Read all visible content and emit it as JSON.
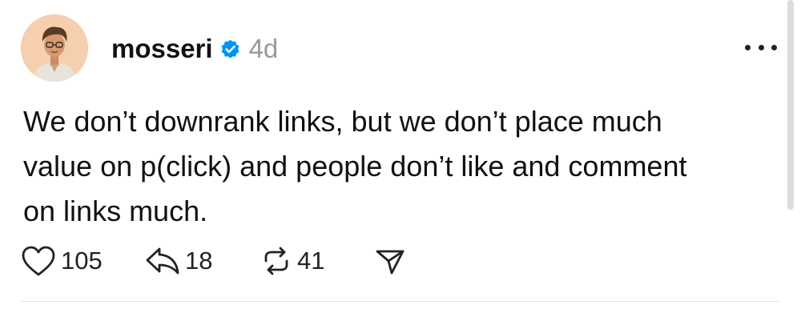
{
  "post": {
    "username": "mosseri",
    "verified": true,
    "timestamp": "4d",
    "body_lines": [
      "We don’t downrank links, but we don’t place much",
      "value on p(click) and people don’t like and comment",
      "on links much."
    ],
    "likes": "105",
    "replies": "18",
    "reposts": "41"
  },
  "icons": {
    "avatar": "user-avatar-illustration",
    "verified": "verified-badge-icon",
    "more": "more-options-icon",
    "like": "heart-icon",
    "reply": "reply-icon",
    "repost": "repost-icon",
    "share": "send-icon"
  },
  "colors": {
    "verified_badge": "#0095f6",
    "timestamp": "#9a9a9a",
    "avatar_bg": "#f3c7a3"
  }
}
